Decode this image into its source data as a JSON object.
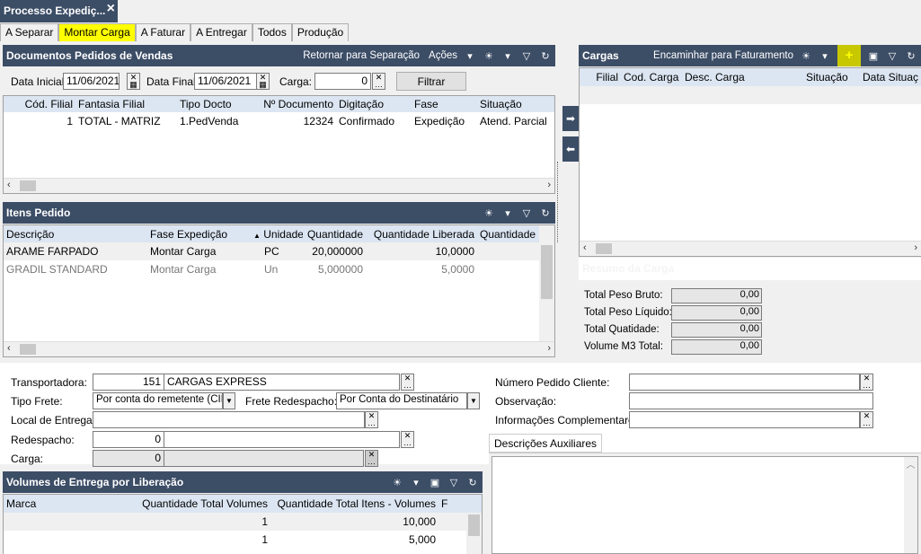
{
  "window": {
    "title": "Processo Expediç...",
    "close": "×"
  },
  "tabs": [
    "A Separar",
    "Montar Carga",
    "A Faturar",
    "A Entregar",
    "Todos",
    "Produção"
  ],
  "docs": {
    "title": "Documentos Pedidos de Vendas",
    "action_return": "Retornar para Separação",
    "action_actions": "Ações",
    "filters": {
      "data_inicial_label": "Data Inicial:",
      "data_inicial": "11/06/2021",
      "data_final_label": "Data Final:",
      "data_final": "11/06/2021",
      "carga_label": "Carga:",
      "carga": "0",
      "filter_button": "Filtrar"
    },
    "columns": [
      "Cód. Filial",
      "Fantasia Filial",
      "Tipo Docto",
      "Nº Documento",
      "Digitação",
      "Fase",
      "Situação"
    ],
    "rows": [
      [
        "1",
        "TOTAL - MATRIZ",
        "1.PedVenda",
        "12324",
        "Confirmado",
        "Expedição",
        "Atend. Parcial"
      ]
    ]
  },
  "cargas": {
    "title": "Cargas",
    "action_forward": "Encaminhar para Faturamento",
    "columns": [
      "Filial",
      "Cod. Carga",
      "Desc. Carga",
      "Situação",
      "Data Situaç"
    ],
    "resumo_title": "Resumo da Carga",
    "totals": [
      {
        "label": "Total Peso Bruto:",
        "value": "0,00"
      },
      {
        "label": "Total Peso Líquido:",
        "value": "0,00"
      },
      {
        "label": "Total Quatidade:",
        "value": "0,00"
      },
      {
        "label": "Volume M3 Total:",
        "value": "0,00"
      }
    ]
  },
  "itens": {
    "title": "Itens Pedido",
    "columns": [
      "Descrição",
      "Fase Expedição",
      "Unidade",
      "Quantidade",
      "Quantidade Liberada",
      "Quantidade"
    ],
    "rows": [
      [
        "ARAME FARPADO",
        "Montar Carga",
        "PC",
        "20,000000",
        "10,0000",
        ""
      ],
      [
        "GRADIL STANDARD",
        "Montar Carga",
        "Un",
        "5,000000",
        "5,0000",
        ""
      ]
    ]
  },
  "form": {
    "transportadora_label": "Transportadora:",
    "transportadora_code": "151",
    "transportadora_name": "CARGAS EXPRESS",
    "tipo_frete_label": "Tipo Frete:",
    "tipo_frete": "Por conta do remetente (CIF)",
    "frete_redespacho_label": "Frete Redespacho:",
    "frete_redespacho": "Por Conta do Destinatário",
    "local_entrega_label": "Local de Entrega:",
    "redespacho_label": "Redespacho:",
    "redespacho_code": "0",
    "carga_label": "Carga:",
    "carga_code": "0",
    "numero_pedido_label": "Número Pedido Cliente:",
    "observacao_label": "Observação:",
    "info_compl_label": "Informações Complementares:",
    "desc_aux_tab": "Descrições Auxiliares"
  },
  "volumes": {
    "title": "Volumes de Entrega por Liberação",
    "columns": [
      "Marca",
      "Quantidade Total Volumes",
      "Quantidade Total Itens - Volumes",
      "F"
    ],
    "rows": [
      [
        "",
        "1",
        "10,000"
      ],
      [
        "",
        "1",
        "5,000"
      ]
    ]
  }
}
